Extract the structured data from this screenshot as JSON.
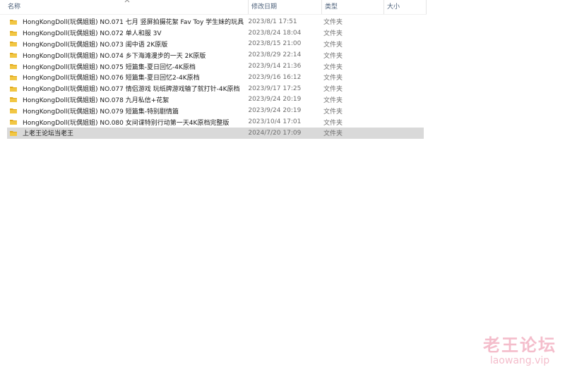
{
  "columns": {
    "name": "名称",
    "date": "修改日期",
    "type": "类型",
    "size": "大小"
  },
  "icons": {
    "folder": "folder-icon",
    "sort": "chevron-up-icon"
  },
  "colors": {
    "folder": "#f2c744",
    "folder_dark": "#e0a91c",
    "selection": "#d9d9d9",
    "watermark": "#f3b2c3"
  },
  "files": [
    {
      "name": "HongKongDoll(玩偶姐姐) NO.071 七月 竖屏拍摄花絮 Fav Toy 学生妹的玩具",
      "date": "2023/8/1 17:51",
      "type": "文件夹",
      "size": ""
    },
    {
      "name": "HongKongDoll(玩偶姐姐) NO.072 单人和服 3V",
      "date": "2023/8/24 18:04",
      "type": "文件夹",
      "size": ""
    },
    {
      "name": "HongKongDoll(玩偶姐姐) NO.073 闺中语 2K原版",
      "date": "2023/8/15 21:00",
      "type": "文件夹",
      "size": ""
    },
    {
      "name": "HongKongDoll(玩偶姐姐) NO.074 乡下海滩漫步的一天 2K原版",
      "date": "2023/8/29 22:14",
      "type": "文件夹",
      "size": ""
    },
    {
      "name": "HongKongDoll(玩偶姐姐) NO.075 短篇集-夏日回忆-4K原档",
      "date": "2023/9/14 21:36",
      "type": "文件夹",
      "size": ""
    },
    {
      "name": "HongKongDoll(玩偶姐姐) NO.076 短篇集-夏日回忆2-4K原档",
      "date": "2023/9/16 16:12",
      "type": "文件夹",
      "size": ""
    },
    {
      "name": "HongKongDoll(玩偶姐姐) NO.077 情侣游戏 玩纸牌游戏输了就打针-4K原档",
      "date": "2023/9/17 17:25",
      "type": "文件夹",
      "size": ""
    },
    {
      "name": "HongKongDoll(玩偶姐姐) NO.078 九月私信+花絮",
      "date": "2023/9/24 20:19",
      "type": "文件夹",
      "size": ""
    },
    {
      "name": "HongKongDoll(玩偶姐姐) NO.079 短篇集-特别剧情篇",
      "date": "2023/9/24 20:19",
      "type": "文件夹",
      "size": ""
    },
    {
      "name": "HongKongDoll(玩偶姐姐) NO.080 女间谍特别行动第一天4K原档完整版",
      "date": "2023/10/4 17:01",
      "type": "文件夹",
      "size": ""
    },
    {
      "name": "上老王论坛当老王",
      "date": "2024/7/20 17:09",
      "type": "文件夹",
      "size": "",
      "selected": true
    }
  ],
  "watermark": {
    "cn": "老王论坛",
    "en": "laowang.vip"
  }
}
